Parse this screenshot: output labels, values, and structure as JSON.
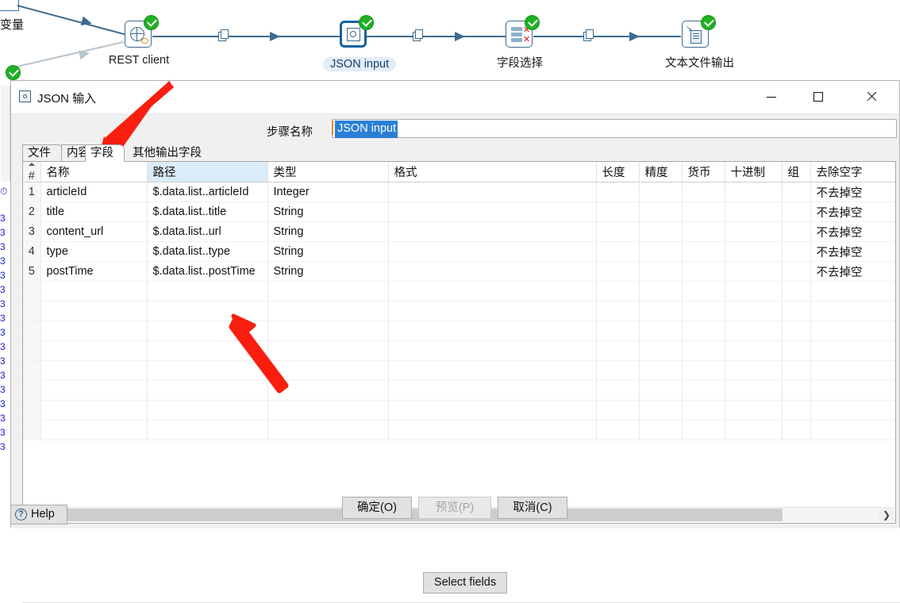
{
  "canvas": {
    "partial_label": "变量",
    "steps": [
      {
        "name": "REST client",
        "label": "REST client",
        "highlighted": false
      },
      {
        "name": "JSON input",
        "label": "JSON input",
        "highlighted": true
      },
      {
        "name": "field-select",
        "label": "字段选择",
        "highlighted": false
      },
      {
        "name": "text-file-output",
        "label": "文本文件输出",
        "highlighted": false
      }
    ]
  },
  "dialog": {
    "title": "JSON 输入",
    "window_buttons": {
      "minimize": "minimize-icon",
      "maximize": "maximize-icon",
      "close": "close-icon"
    },
    "step_name": {
      "label": "步骤名称",
      "value": "JSON input",
      "selected": true
    },
    "tabs": [
      {
        "label": "文件",
        "active": false
      },
      {
        "label": "内容",
        "active": false
      },
      {
        "label": "字段",
        "active": true
      },
      {
        "label": "其他输出字段",
        "active": false
      }
    ],
    "table": {
      "columns": [
        {
          "key": "num",
          "label": "#",
          "highlighted": false
        },
        {
          "key": "name",
          "label": "名称",
          "highlighted": false
        },
        {
          "key": "path",
          "label": "路径",
          "highlighted": true
        },
        {
          "key": "type",
          "label": "类型",
          "highlighted": false
        },
        {
          "key": "format",
          "label": "格式",
          "highlighted": false
        },
        {
          "key": "length",
          "label": "长度",
          "highlighted": false
        },
        {
          "key": "precision",
          "label": "精度",
          "highlighted": false
        },
        {
          "key": "currency",
          "label": "货币",
          "highlighted": false
        },
        {
          "key": "decimal",
          "label": "十进制",
          "highlighted": false
        },
        {
          "key": "group",
          "label": "组",
          "highlighted": false
        },
        {
          "key": "trim",
          "label": "去除空字",
          "highlighted": false
        }
      ],
      "rows": [
        {
          "num": "1",
          "name": "articleId",
          "path": "$.data.list..articleId",
          "type": "Integer",
          "format": "",
          "length": "",
          "precision": "",
          "currency": "",
          "decimal": "",
          "group": "",
          "trim": "不去掉空"
        },
        {
          "num": "2",
          "name": "title",
          "path": "$.data.list..title",
          "type": "String",
          "format": "",
          "length": "",
          "precision": "",
          "currency": "",
          "decimal": "",
          "group": "",
          "trim": "不去掉空"
        },
        {
          "num": "3",
          "name": "content_url",
          "path": "$.data.list..url",
          "type": "String",
          "format": "",
          "length": "",
          "precision": "",
          "currency": "",
          "decimal": "",
          "group": "",
          "trim": "不去掉空"
        },
        {
          "num": "4",
          "name": "type",
          "path": "$.data.list..type",
          "type": "String",
          "format": "",
          "length": "",
          "precision": "",
          "currency": "",
          "decimal": "",
          "group": "",
          "trim": "不去掉空"
        },
        {
          "num": "5",
          "name": "postTime",
          "path": "$.data.list..postTime",
          "type": "String",
          "format": "",
          "length": "",
          "precision": "",
          "currency": "",
          "decimal": "",
          "group": "",
          "trim": "不去掉空"
        }
      ],
      "empty_row_count": 8
    },
    "select_fields_button": "Select fields",
    "buttons": {
      "ok": "确定(O)",
      "preview": "预览(P)",
      "cancel": "取消(C)",
      "preview_disabled": true
    },
    "help_button": "Help"
  },
  "colors": {
    "accent_blue": "#2a7fd4",
    "selection_blue": "#dbebf7",
    "hop_blue": "#3d6b8e",
    "status_green": "#20b024",
    "annotation_red": "#fa1e0e"
  }
}
